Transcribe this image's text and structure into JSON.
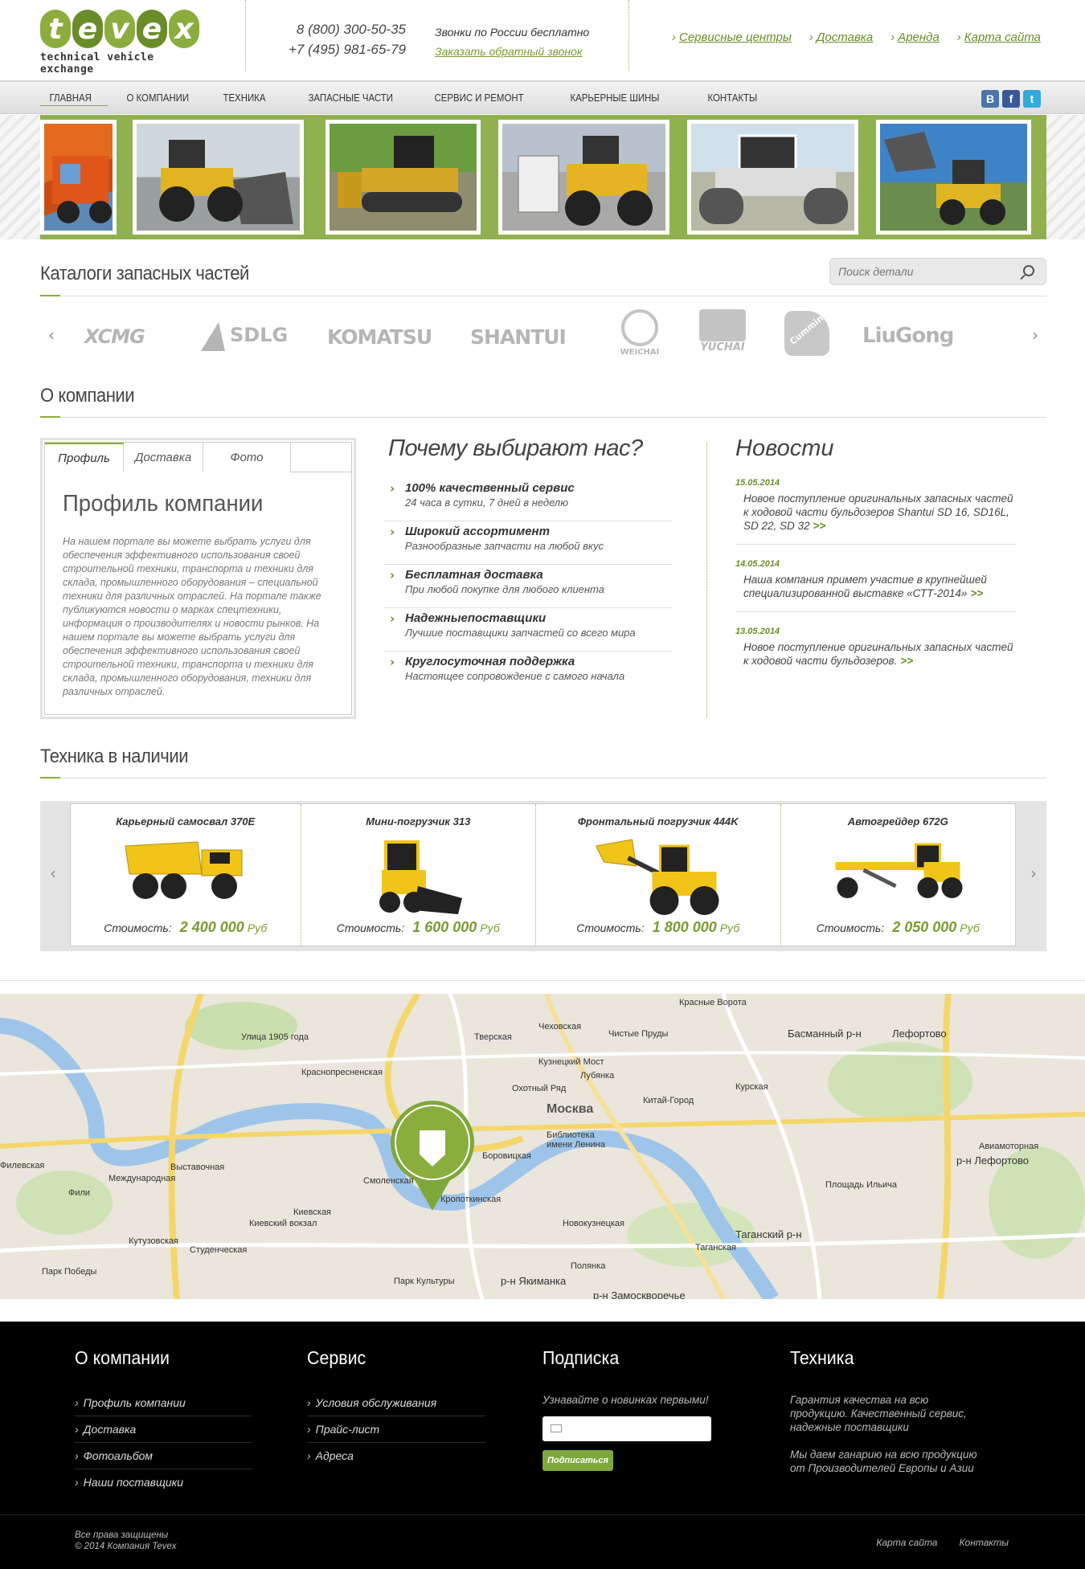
{
  "header": {
    "logo_letters": [
      "t",
      "e",
      "v",
      "e",
      "x"
    ],
    "logo_subtitle": "technical vehicle exchange",
    "phones": [
      "8 (800) 300-50-35",
      "+7 (495) 981-65-79"
    ],
    "free_calls": "Звонки по России бесплатно",
    "callback": "Заказать обратный звонок",
    "top_links": [
      "Сервисные центры",
      "Доставка",
      "Аренда",
      "Карта сайта"
    ],
    "arrow_glyph": "›"
  },
  "nav": {
    "items": [
      "Главная",
      "О компании",
      "Техника",
      "Запасные части",
      "Сервис и ремонт",
      "Карьерные шины",
      "Контакты"
    ],
    "social": [
      {
        "icon": "vk-icon",
        "glyph": "B",
        "color": "#4a76a8"
      },
      {
        "icon": "facebook-icon",
        "glyph": "f",
        "color": "#3b5998"
      },
      {
        "icon": "twitter-icon",
        "glyph": "t",
        "color": "#33aadd"
      }
    ]
  },
  "catalog": {
    "title": "Каталоги запасных частей",
    "search_placeholder": "Поиск детали",
    "brands": [
      "XCMG",
      "SDLG",
      "KOMATSU",
      "SHANTUI",
      "WEICHAI",
      "YUCHAI",
      "Cummins",
      "LiuGong"
    ],
    "prev": "‹",
    "next": "›"
  },
  "about": {
    "title": "О компании",
    "tabs": [
      "Профиль",
      "Доставка",
      "Фото"
    ],
    "profile_title": "Профиль компании",
    "profile_text": "На нашем портале вы можете выбрать услуги для обеспечения эффективного использования своей строительной техники, транспорта и техники для склада, промышленного оборудования – специальной техники для различных отраслей. На портале также публикуются новости о марках спецтехники, информация о производителях и новости рынков. На нашем портале вы можете выбрать услуги для обеспечения эффективного использования своей строительной техники, транспорта и техники для склада, промышленного оборудования, техники для различных отраслей.",
    "why_title": "Почему выбирают нас?",
    "why": [
      {
        "title": "100% качественный сервис",
        "sub": "24 часа в сутки, 7 дней в неделю"
      },
      {
        "title": "Широкий ассортимент",
        "sub": "Разнообразные запчасти на любой вкус"
      },
      {
        "title": "Бесплатная доставка",
        "sub": "При любой покупке для любого клиента"
      },
      {
        "title": "Надежныепоставщики",
        "sub": "Лучшие поставщики запчастей со всего мира"
      },
      {
        "title": "Круглосуточная поддержка",
        "sub": "Настоящее сопровождение с самого начала"
      }
    ],
    "news_title": "Новости",
    "news": [
      {
        "date": "15.05.2014",
        "text": "Новое поступление оригинальных запасных частей к ходовой части бульдозеров Shantui SD 16, SD16L, SD 22, SD 32",
        "more": ">>"
      },
      {
        "date": "14.05.2014",
        "text": "Наша компания примет участие в крупнейшей специализированной выставке «СТТ-2014»",
        "more": ">>"
      },
      {
        "date": "13.05.2014",
        "text": "Новое поступление оригинальных запасных частей к ходовой части бульдозеров.",
        "more": ">>"
      }
    ]
  },
  "equipment": {
    "title": "Техника в наличии",
    "price_label": "Стоимость:",
    "items": [
      {
        "name": "Карьерный самосвал 370E",
        "price": "2 400 000",
        "currency": "Руб"
      },
      {
        "name": "Мини-погрузчик 313",
        "price": "1 600 000",
        "currency": "Руб"
      },
      {
        "name": "Фронтальный погрузчик 444K",
        "price": "1 800 000",
        "currency": "Руб"
      },
      {
        "name": "Автогрейдер 672G",
        "price": "2 050 000",
        "currency": "Руб"
      }
    ]
  },
  "map": {
    "labels": [
      "Улица 1905 года",
      "Краснопресненская",
      "Тверская",
      "Чеховская",
      "Чистые Пруды",
      "Красные Ворота",
      "Басманный р-н",
      "Лефортово",
      "Кузнецкий Мост",
      "Лубянка",
      "Охотный Ряд",
      "Москва",
      "Китай-Город",
      "Курская",
      "Выставочная",
      "Международная",
      "Смоленская",
      "Библиотека имени Ленина",
      "Боровицкая",
      "Кропоткинская",
      "Филевская",
      "Фили",
      "Кутузовская",
      "Киевская",
      "Киевский вокзал",
      "Студенческая",
      "Парк Победы",
      "Парк Культуры",
      "р-н Якиманка",
      "Новокузнецкая",
      "Полянка",
      "Таганский р-н",
      "Таганская",
      "Площадь Ильича",
      "р-н Лефортово",
      "Авиамоторная",
      "р-н Замоскворечье"
    ]
  },
  "footer": {
    "about": {
      "title": "О компании",
      "links": [
        "Профиль компании",
        "Доставка",
        "Фотоальбом",
        "Наши поставщики"
      ]
    },
    "service": {
      "title": "Сервис",
      "links": [
        "Условия обслуживания",
        "Прайс-лист",
        "Адреса"
      ]
    },
    "subscribe": {
      "title": "Подписка",
      "text": "Узнавайте о новинках первыми!",
      "button": "Подписаться"
    },
    "tech": {
      "title": "Техника",
      "p1": "Гарантия качества на всю продукцию. Качественный сервис, надежные поставщики",
      "p2": "Мы даем ганарию на всю продукцию от Производителей Европы и Азии"
    },
    "copyright": [
      "Все права защищены",
      "© 2014 Компания Tevex"
    ],
    "bottom_links": [
      "Карта сайта",
      "Контакты"
    ]
  },
  "colors": {
    "accent": "#8bad3d",
    "accent_dark": "#6b8c2a",
    "footer_bg": "#000000"
  }
}
